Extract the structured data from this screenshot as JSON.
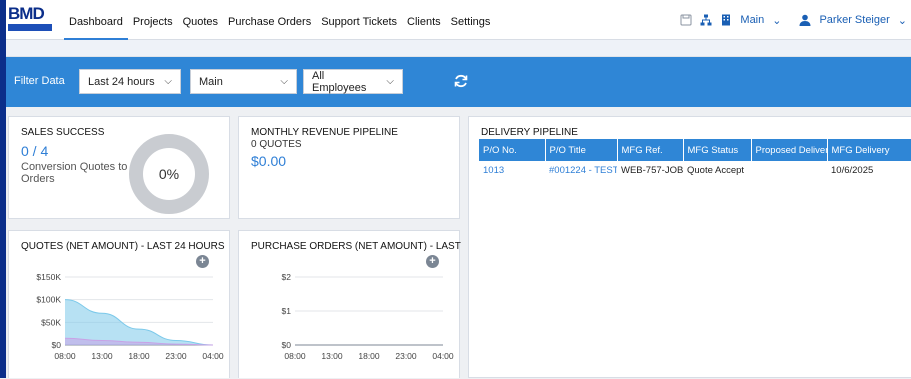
{
  "brand": {
    "logo_text": "BMD"
  },
  "nav": {
    "items": [
      "Dashboard",
      "Projects",
      "Quotes",
      "Purchase Orders",
      "Support Tickets",
      "Clients",
      "Settings"
    ],
    "active": "Dashboard"
  },
  "topright": {
    "location": "Main",
    "user": "Parker Steiger"
  },
  "filters": {
    "label": "Filter Data",
    "time": "Last 24 hours",
    "location": "Main",
    "employees": "All Employees"
  },
  "sales_success": {
    "title": "SALES SUCCESS",
    "value": "0 / 4",
    "subtitle": "Conversion Quotes to Orders",
    "percent_label": "0%",
    "percent": 0
  },
  "monthly_revenue": {
    "title": "MONTHLY REVENUE PIPELINE",
    "count": "0 QUOTES",
    "value": "$0.00"
  },
  "delivery_pipeline": {
    "title": "DELIVERY PIPELINE",
    "columns": [
      "P/O No.",
      "P/O Title",
      "MFG Ref.",
      "MFG Status",
      "Proposed Delivery",
      "MFG Delivery"
    ],
    "rows": [
      [
        "1013",
        "#001224 - TEST",
        "WEB-757-JOB",
        "Quote Accept",
        "",
        "10/6/2025"
      ]
    ]
  },
  "quotes_chart": {
    "title": "QUOTES (NET AMOUNT) - LAST 24 HOURS",
    "plus": "+"
  },
  "po_chart": {
    "title": "PURCHASE ORDERS (NET AMOUNT) - LAST",
    "plus": "+"
  },
  "chart_data": [
    {
      "type": "area",
      "categories": [
        "08:00",
        "13:00",
        "18:00",
        "23:00",
        "04:00"
      ],
      "yticks": [
        "$0",
        "$50K",
        "$100K",
        "$150K"
      ],
      "ylim": [
        0,
        150
      ],
      "x": [
        0,
        1,
        2,
        3,
        4
      ],
      "series": [
        {
          "values": [
            100,
            70,
            35,
            10,
            0
          ],
          "color": "#7cc9ea"
        },
        {
          "values": [
            15,
            10,
            6,
            2,
            0
          ],
          "color": "#c8a2e6"
        }
      ]
    },
    {
      "type": "line",
      "categories": [
        "08:00",
        "13:00",
        "18:00",
        "23:00",
        "04:00"
      ],
      "yticks": [
        "$0",
        "$1",
        "$2"
      ],
      "ylim": [
        0,
        2
      ],
      "x": [
        0,
        1,
        2,
        3,
        4
      ],
      "series": [
        {
          "values": [
            0,
            0,
            0,
            0,
            0
          ],
          "color": "#7e8794"
        }
      ]
    }
  ],
  "colors": {
    "accent": "#2f86d6",
    "navy": "#0b2e8a"
  }
}
